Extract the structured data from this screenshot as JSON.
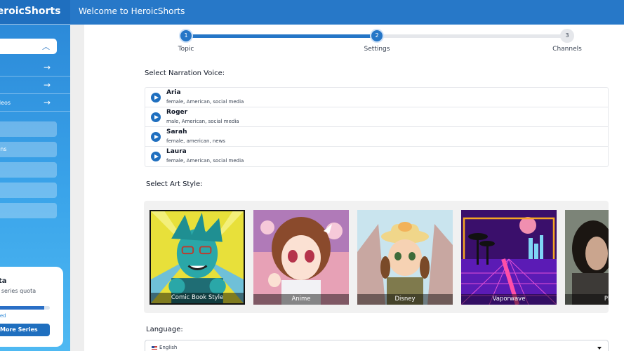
{
  "sidebar": {
    "brand": "HeroicShorts",
    "nav": [
      {
        "label": ""
      },
      {
        "label": ""
      },
      {
        "label": "deos"
      }
    ],
    "buttons": [
      {
        "label": ""
      },
      {
        "label": "tions"
      },
      {
        "label": "t"
      },
      {
        "label": "t"
      },
      {
        "label": ""
      }
    ],
    "quota": {
      "title": "ta",
      "subtitle": "r series quota",
      "used_label": "ced",
      "fill_fraction": 0.9,
      "button_label": "More Series"
    }
  },
  "header": {
    "title": "Welcome to HeroicShorts"
  },
  "stepper": {
    "steps": [
      {
        "number": "1",
        "label": "Topic",
        "status": "done"
      },
      {
        "number": "2",
        "label": "Settings",
        "status": "current"
      },
      {
        "number": "3",
        "label": "Channels",
        "status": "todo"
      }
    ]
  },
  "narration": {
    "title": "Select Narration Voice:",
    "voices": [
      {
        "name": "Aria",
        "description": "female, American, social media"
      },
      {
        "name": "Roger",
        "description": "male, American, social media"
      },
      {
        "name": "Sarah",
        "description": "female, american, news"
      },
      {
        "name": "Laura",
        "description": "female, American, social media"
      }
    ]
  },
  "art": {
    "title": "Select Art Style:",
    "styles": [
      {
        "label": "Comic Book Style",
        "selected": true
      },
      {
        "label": "Anime",
        "selected": false
      },
      {
        "label": "Disney",
        "selected": false
      },
      {
        "label": "Vaporwave",
        "selected": false
      },
      {
        "label": "Photo",
        "selected": false
      }
    ]
  },
  "language": {
    "title": "Language:",
    "value": "English"
  },
  "colors": {
    "header": "#2778c8",
    "primary": "#1f6fbf",
    "sidebar_top": "#2a86d6",
    "sidebar_bottom": "#4fb9f2"
  }
}
